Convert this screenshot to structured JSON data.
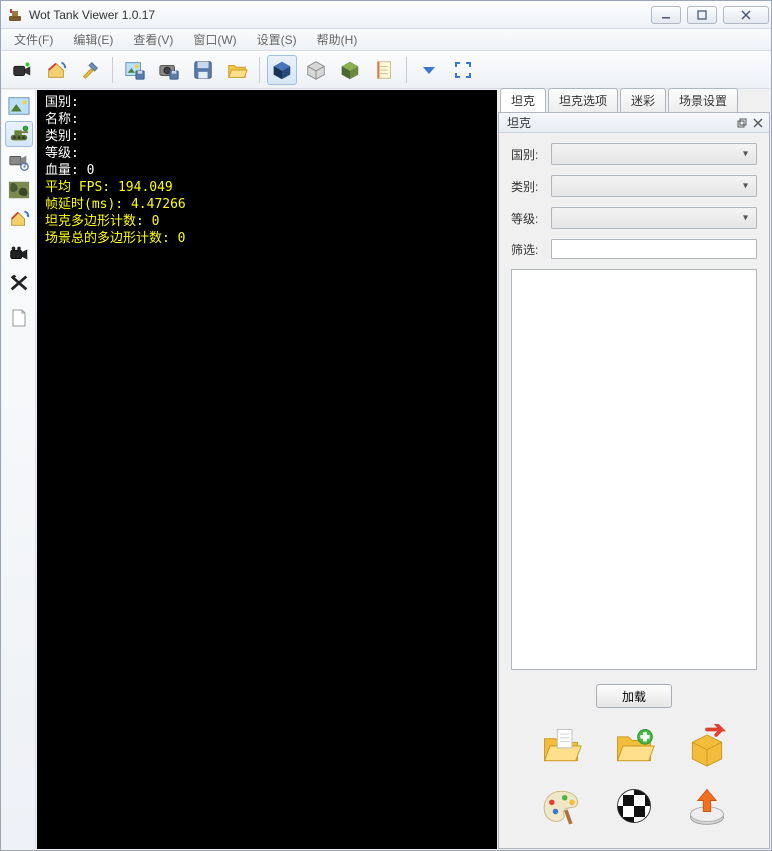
{
  "window": {
    "title": "Wot Tank Viewer 1.0.17"
  },
  "menu": {
    "file": "文件(F)",
    "edit": "编辑(E)",
    "view": "查看(V)",
    "window": "窗口(W)",
    "config": "设置(S)",
    "help": "帮助(H)"
  },
  "viewport": {
    "lines": {
      "country_label": "国别:",
      "name_label": "名称:",
      "type_label": "类别:",
      "tier_label": "等级:",
      "hp_label": "血量:",
      "hp_value": "0",
      "fps_label": "平均 FPS:",
      "fps_value": "194.049",
      "lat_label": "帧延时(ms):",
      "lat_value": "4.47266",
      "tankpoly_label": "坦克多边形计数:",
      "tankpoly_value": "0",
      "scenepoly_label": "场景总的多边形计数:",
      "scenepoly_value": "0"
    }
  },
  "tabs": {
    "tank": "坦克",
    "tank_opts": "坦克选项",
    "camo": "迷彩",
    "scene": "场景设置"
  },
  "pane": {
    "header": "坦克",
    "form": {
      "country": "国别:",
      "type": "类别:",
      "tier": "等级:",
      "filter": "筛选:"
    },
    "load_btn": "加载"
  }
}
